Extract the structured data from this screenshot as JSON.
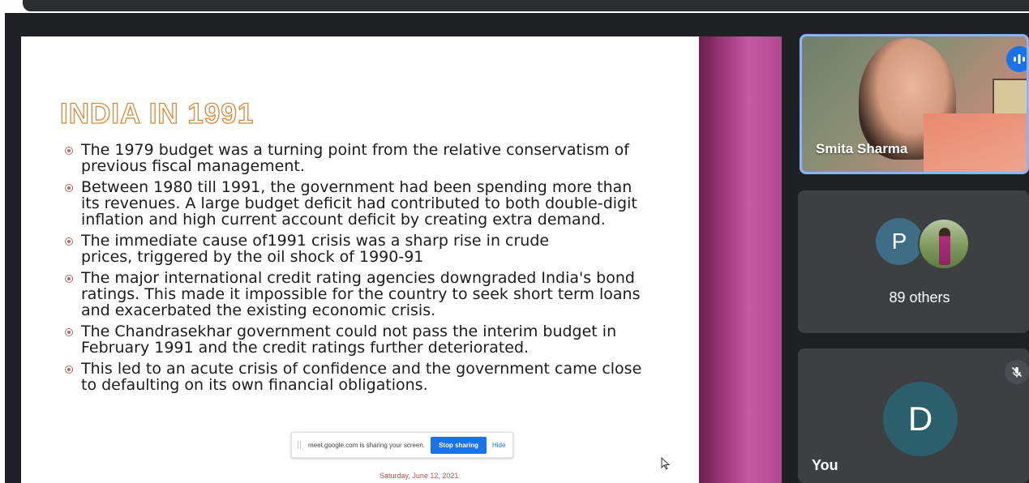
{
  "slide": {
    "title": "INDIA IN 1991",
    "bullets": [
      {
        "line1": "The 1979 budget was a turning point from the relative conservatism of",
        "line2": "previous fiscal management.",
        "line3": ""
      },
      {
        "line1": "Between 1980 till 1991, the government had been spending more than",
        "line2": "its revenues. A large budget deficit had contributed to both double-digit",
        "line3": "inflation and high current account deficit by creating extra demand."
      },
      {
        "line1": "The immediate cause of1991 crisis was a sharp rise in crude",
        "line2": "prices, triggered by the oil shock of 1990-91",
        "line3": ""
      },
      {
        "line1": "The major international credit rating agencies downgraded India's bond",
        "line2": "ratings. This made it impossible for the country to seek short term loans",
        "line3": "and exacerbated the existing economic crisis."
      },
      {
        "line1": "The Chandrasekhar government could not pass the interim budget in",
        "line2": "February 1991 and the credit ratings further deteriorated.",
        "line3": ""
      },
      {
        "line1": "This led to an acute crisis of confidence and the government came close",
        "line2": "to defaulting on its own financial obligations.",
        "line3": ""
      }
    ],
    "date": "Saturday, June 12, 2021"
  },
  "share_bar": {
    "message": "meet.google.com is sharing your screen.",
    "stop_label": "Stop sharing",
    "hide_label": "Hide"
  },
  "participants": {
    "speaker_name": "Smita Sharma",
    "others_initial": "P",
    "others_label": "89 others",
    "you_initial": "D",
    "you_label": "You"
  },
  "icons": {
    "speaking": "audio-level-icon",
    "mic_off": "mic-off-icon",
    "cursor": "mouse-pointer-icon"
  },
  "colors": {
    "accent_blue": "#1a73e8",
    "speaker_border": "#8ab4f8",
    "title_outline": "#d9893a",
    "bullet": "#b46b6b",
    "date_red": "#c0504d"
  }
}
